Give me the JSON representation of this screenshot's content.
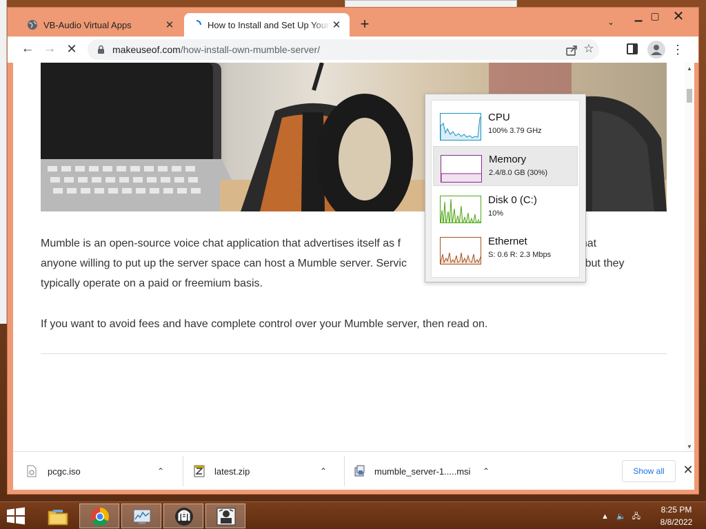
{
  "browser": {
    "tabs": [
      {
        "title": "VB-Audio Virtual Apps",
        "favicon": "globe-icon"
      },
      {
        "title": "How to Install and Set Up Your Own Mumble Server",
        "favicon": "loading-spinner-icon",
        "active": true
      }
    ],
    "url": {
      "host": "makeuseof.com",
      "path": "/how-install-own-mumble-server/"
    }
  },
  "article": {
    "paragraph1_parts": [
      "Mumble is an open-source voice chat application that advertises itself as f",
      "s free in that",
      "anyone willing to put up the server space can host a Mumble server. Servic",
      "ou, but they",
      "typically operate on a paid or freemium basis."
    ],
    "paragraph2": "If you want to avoid fees and have complete control over your Mumble server, then read on."
  },
  "task_manager": {
    "cpu": {
      "title": "CPU",
      "detail": "100%  3.79 GHz",
      "color": "#1a8fbd"
    },
    "memory": {
      "title": "Memory",
      "detail": "2.4/8.0 GB (30%)",
      "color": "#8b2a8b"
    },
    "disk": {
      "title": "Disk 0 (C:)",
      "detail": "10%",
      "color": "#4da617"
    },
    "ethernet": {
      "title": "Ethernet",
      "detail": "S: 0.6  R: 2.3 Mbps",
      "color": "#a7531c"
    }
  },
  "downloads": {
    "items": [
      {
        "name": "pcgc.iso",
        "icon": "disc-file-icon"
      },
      {
        "name": "latest.zip",
        "icon": "zip-file-icon"
      },
      {
        "name": "mumble_server-1.....msi",
        "icon": "installer-file-icon"
      }
    ],
    "show_all": "Show all"
  },
  "taskbar": {
    "apps": [
      "file-explorer-icon",
      "chrome-icon",
      "task-manager-icon",
      "mumble-icon",
      "murmur-icon"
    ],
    "time": "8:25 PM",
    "date": "8/8/2022"
  }
}
